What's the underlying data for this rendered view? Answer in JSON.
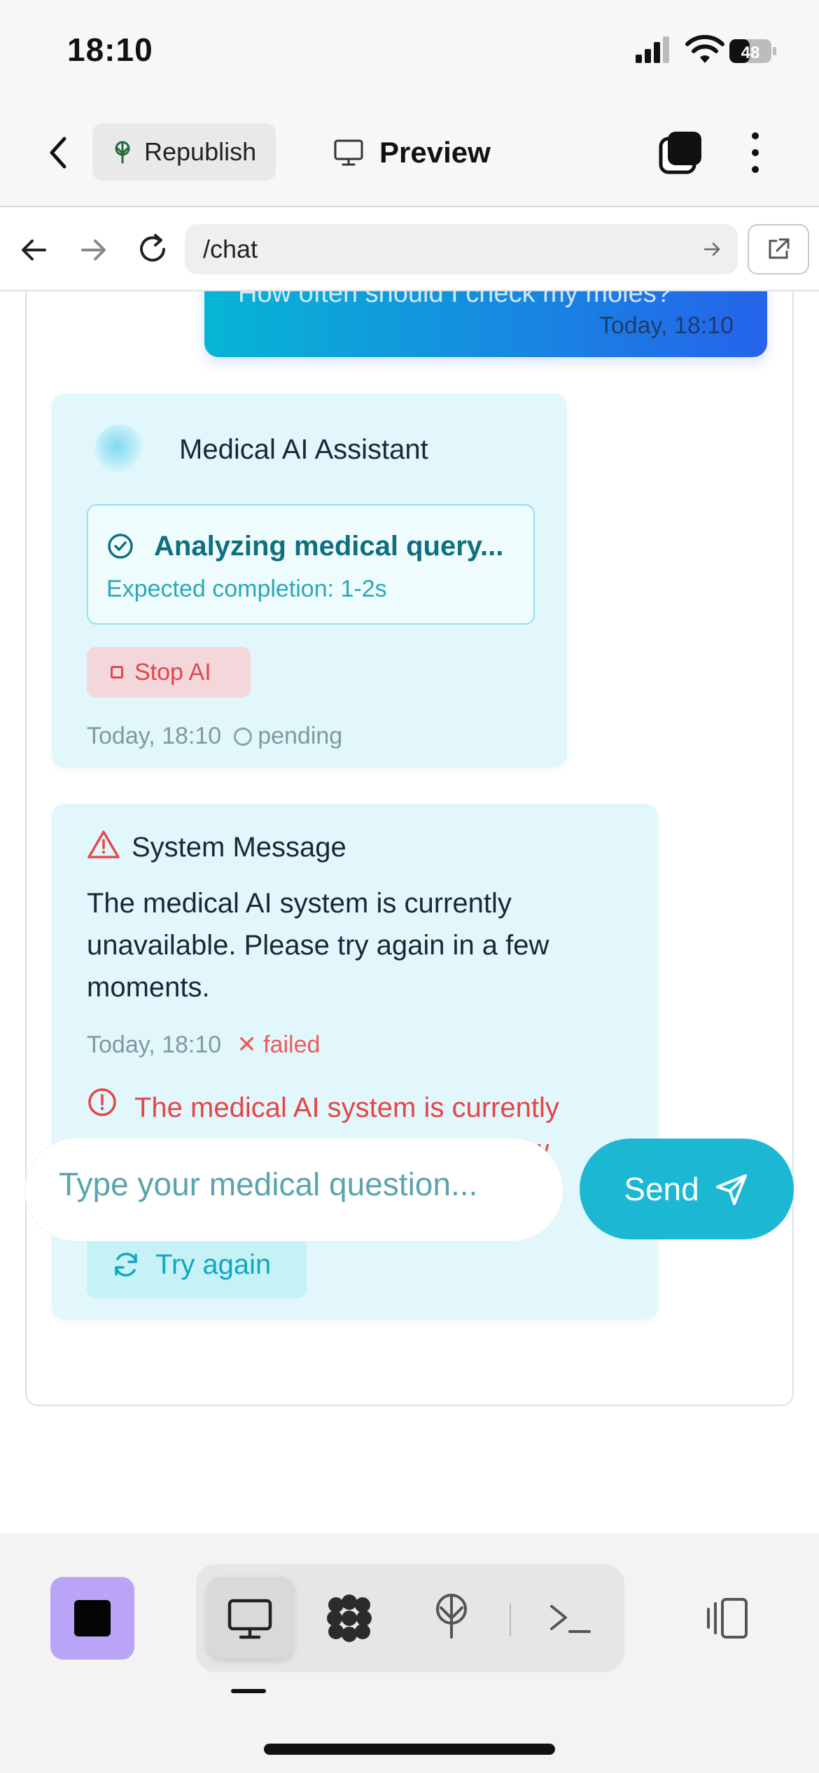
{
  "status_bar": {
    "time": "18:10",
    "battery": "48"
  },
  "header": {
    "republish_label": "Republish",
    "preview_label": "Preview"
  },
  "browser": {
    "url": "/chat"
  },
  "chat": {
    "user_message": {
      "text": "How often should I check my moles?",
      "timestamp": "Today, 18:10"
    },
    "assistant": {
      "name": "Medical AI Assistant",
      "status_title": "Analyzing medical query...",
      "status_sub": "Expected completion: 1-2s",
      "stop_label": "Stop AI",
      "timestamp": "Today, 18:10",
      "state": "pending"
    },
    "system_message": {
      "title": "System Message",
      "body": "The medical AI system is currently unavailable. Please try again in a few moments.",
      "timestamp": "Today, 18:10",
      "state": "failed",
      "error_text": "The medical AI system is currently unavailable. Please try again in a few moments.",
      "retry_label": "Try again"
    }
  },
  "composer": {
    "placeholder": "Type your medical question...",
    "send_label": "Send"
  },
  "colors": {
    "accent": "#1cb8d3",
    "user_gradient_start": "#06b6d4",
    "user_gradient_end": "#2563eb",
    "error": "#e64545",
    "stop_button_bg": "#b9a4f7"
  },
  "icons": [
    "back-chevron-icon",
    "republish-tree-icon",
    "monitor-icon",
    "tabs-icon",
    "more-vertical-icon",
    "arrow-left-icon",
    "arrow-right-icon",
    "reload-icon",
    "open-external-icon",
    "check-circle-icon",
    "warning-triangle-icon",
    "error-circle-icon",
    "refresh-icon",
    "send-icon",
    "pattern-icon",
    "tree-icon",
    "terminal-icon",
    "panel-icon"
  ]
}
